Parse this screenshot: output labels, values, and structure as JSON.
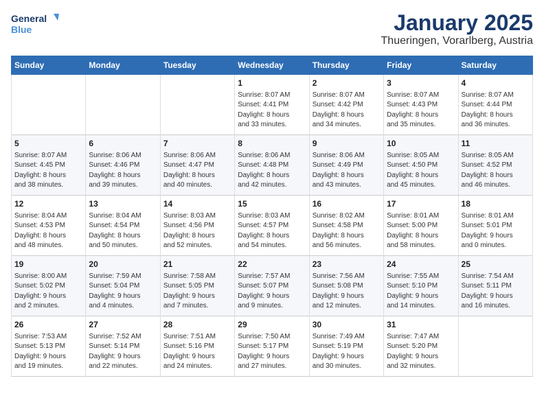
{
  "header": {
    "logo_line1": "General",
    "logo_line2": "Blue",
    "title": "January 2025",
    "subtitle": "Thueringen, Vorarlberg, Austria"
  },
  "days_of_week": [
    "Sunday",
    "Monday",
    "Tuesday",
    "Wednesday",
    "Thursday",
    "Friday",
    "Saturday"
  ],
  "weeks": [
    [
      {
        "day": "",
        "content": ""
      },
      {
        "day": "",
        "content": ""
      },
      {
        "day": "",
        "content": ""
      },
      {
        "day": "1",
        "content": "Sunrise: 8:07 AM\nSunset: 4:41 PM\nDaylight: 8 hours\nand 33 minutes."
      },
      {
        "day": "2",
        "content": "Sunrise: 8:07 AM\nSunset: 4:42 PM\nDaylight: 8 hours\nand 34 minutes."
      },
      {
        "day": "3",
        "content": "Sunrise: 8:07 AM\nSunset: 4:43 PM\nDaylight: 8 hours\nand 35 minutes."
      },
      {
        "day": "4",
        "content": "Sunrise: 8:07 AM\nSunset: 4:44 PM\nDaylight: 8 hours\nand 36 minutes."
      }
    ],
    [
      {
        "day": "5",
        "content": "Sunrise: 8:07 AM\nSunset: 4:45 PM\nDaylight: 8 hours\nand 38 minutes."
      },
      {
        "day": "6",
        "content": "Sunrise: 8:06 AM\nSunset: 4:46 PM\nDaylight: 8 hours\nand 39 minutes."
      },
      {
        "day": "7",
        "content": "Sunrise: 8:06 AM\nSunset: 4:47 PM\nDaylight: 8 hours\nand 40 minutes."
      },
      {
        "day": "8",
        "content": "Sunrise: 8:06 AM\nSunset: 4:48 PM\nDaylight: 8 hours\nand 42 minutes."
      },
      {
        "day": "9",
        "content": "Sunrise: 8:06 AM\nSunset: 4:49 PM\nDaylight: 8 hours\nand 43 minutes."
      },
      {
        "day": "10",
        "content": "Sunrise: 8:05 AM\nSunset: 4:50 PM\nDaylight: 8 hours\nand 45 minutes."
      },
      {
        "day": "11",
        "content": "Sunrise: 8:05 AM\nSunset: 4:52 PM\nDaylight: 8 hours\nand 46 minutes."
      }
    ],
    [
      {
        "day": "12",
        "content": "Sunrise: 8:04 AM\nSunset: 4:53 PM\nDaylight: 8 hours\nand 48 minutes."
      },
      {
        "day": "13",
        "content": "Sunrise: 8:04 AM\nSunset: 4:54 PM\nDaylight: 8 hours\nand 50 minutes."
      },
      {
        "day": "14",
        "content": "Sunrise: 8:03 AM\nSunset: 4:56 PM\nDaylight: 8 hours\nand 52 minutes."
      },
      {
        "day": "15",
        "content": "Sunrise: 8:03 AM\nSunset: 4:57 PM\nDaylight: 8 hours\nand 54 minutes."
      },
      {
        "day": "16",
        "content": "Sunrise: 8:02 AM\nSunset: 4:58 PM\nDaylight: 8 hours\nand 56 minutes."
      },
      {
        "day": "17",
        "content": "Sunrise: 8:01 AM\nSunset: 5:00 PM\nDaylight: 8 hours\nand 58 minutes."
      },
      {
        "day": "18",
        "content": "Sunrise: 8:01 AM\nSunset: 5:01 PM\nDaylight: 9 hours\nand 0 minutes."
      }
    ],
    [
      {
        "day": "19",
        "content": "Sunrise: 8:00 AM\nSunset: 5:02 PM\nDaylight: 9 hours\nand 2 minutes."
      },
      {
        "day": "20",
        "content": "Sunrise: 7:59 AM\nSunset: 5:04 PM\nDaylight: 9 hours\nand 4 minutes."
      },
      {
        "day": "21",
        "content": "Sunrise: 7:58 AM\nSunset: 5:05 PM\nDaylight: 9 hours\nand 7 minutes."
      },
      {
        "day": "22",
        "content": "Sunrise: 7:57 AM\nSunset: 5:07 PM\nDaylight: 9 hours\nand 9 minutes."
      },
      {
        "day": "23",
        "content": "Sunrise: 7:56 AM\nSunset: 5:08 PM\nDaylight: 9 hours\nand 12 minutes."
      },
      {
        "day": "24",
        "content": "Sunrise: 7:55 AM\nSunset: 5:10 PM\nDaylight: 9 hours\nand 14 minutes."
      },
      {
        "day": "25",
        "content": "Sunrise: 7:54 AM\nSunset: 5:11 PM\nDaylight: 9 hours\nand 16 minutes."
      }
    ],
    [
      {
        "day": "26",
        "content": "Sunrise: 7:53 AM\nSunset: 5:13 PM\nDaylight: 9 hours\nand 19 minutes."
      },
      {
        "day": "27",
        "content": "Sunrise: 7:52 AM\nSunset: 5:14 PM\nDaylight: 9 hours\nand 22 minutes."
      },
      {
        "day": "28",
        "content": "Sunrise: 7:51 AM\nSunset: 5:16 PM\nDaylight: 9 hours\nand 24 minutes."
      },
      {
        "day": "29",
        "content": "Sunrise: 7:50 AM\nSunset: 5:17 PM\nDaylight: 9 hours\nand 27 minutes."
      },
      {
        "day": "30",
        "content": "Sunrise: 7:49 AM\nSunset: 5:19 PM\nDaylight: 9 hours\nand 30 minutes."
      },
      {
        "day": "31",
        "content": "Sunrise: 7:47 AM\nSunset: 5:20 PM\nDaylight: 9 hours\nand 32 minutes."
      },
      {
        "day": "",
        "content": ""
      }
    ]
  ]
}
